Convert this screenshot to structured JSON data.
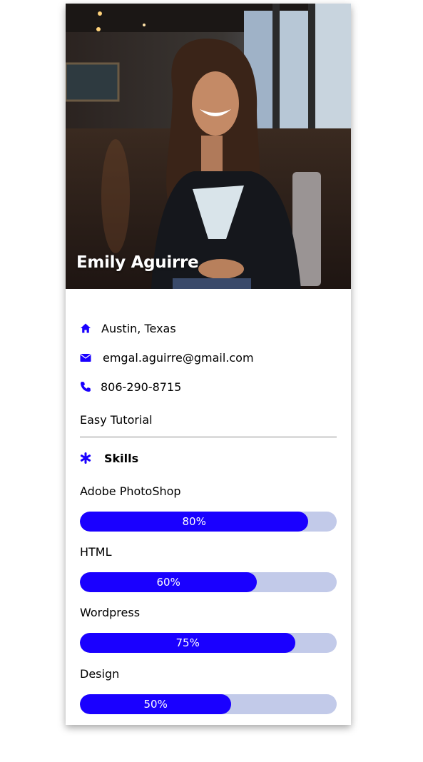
{
  "profile": {
    "name": "Emily Aguirre",
    "location": "Austin, Texas",
    "email": "emgal.aguirre@gmail.com",
    "phone": "806-290-8715",
    "note": "Easy Tutorial"
  },
  "skills": {
    "heading": "Skills",
    "items": [
      {
        "label": "Adobe PhotoShop",
        "percent_text": "80%",
        "fill": 0.89
      },
      {
        "label": "HTML",
        "percent_text": "60%",
        "fill": 0.69
      },
      {
        "label": "Wordpress",
        "percent_text": "75%",
        "fill": 0.84
      },
      {
        "label": "Design",
        "percent_text": "50%",
        "fill": 0.59
      }
    ]
  },
  "theme": {
    "accent": "#1a00ff",
    "track": "#c2cae9"
  },
  "icons": {
    "location": "home-icon",
    "email": "envelope-icon",
    "phone": "phone-icon",
    "skills": "asterisk-icon"
  }
}
